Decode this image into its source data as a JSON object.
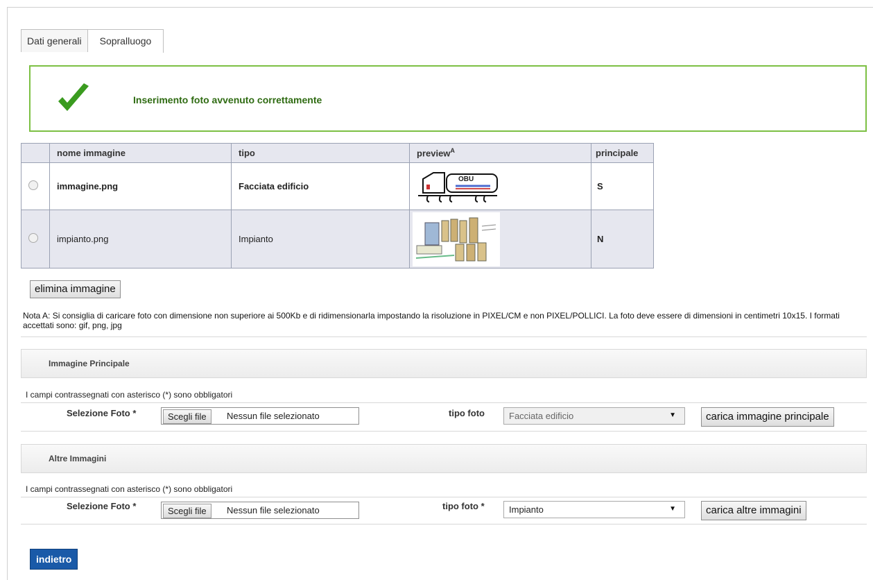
{
  "tabs": [
    "Dati generali",
    "Sopralluogo"
  ],
  "success_message": "Inserimento foto avvenuto correttamente",
  "table": {
    "headers": [
      "nome immagine",
      "tipo",
      "preview",
      "A",
      "principale"
    ],
    "rows": [
      {
        "name": "immagine.png",
        "type": "Facciata edificio",
        "principal": "S"
      },
      {
        "name": "impianto.png",
        "type": "Impianto",
        "principal": "N"
      }
    ]
  },
  "delete_button": "elimina immagine",
  "note": "Nota A: Si consiglia di caricare foto con dimensione non superiore ai 500Kb e di ridimensionarla impostando la risoluzione in PIXEL/CM e non PIXEL/POLLICI. La foto deve essere di dimensioni in centimetri 10x15. I formati accettati sono: gif, png, jpg",
  "main_section": {
    "title": "Immagine Principale",
    "required_note": "I campi contrassegnati con asterisco (*) sono obbligatori",
    "select_photo_label": "Selezione Foto *",
    "file_button": "Scegli file",
    "file_text": "Nessun file selezionato",
    "type_label": "tipo foto",
    "type_value": "Facciata edificio",
    "submit": "carica immagine principale"
  },
  "other_section": {
    "title": "Altre Immagini",
    "required_note": "I campi contrassegnati con asterisco (*) sono obbligatori",
    "select_photo_label": "Selezione Foto *",
    "file_button": "Scegli file",
    "file_text": "Nessun file selezionato",
    "type_label": "tipo foto *",
    "type_value": "Impianto",
    "submit": "carica altre immagini"
  },
  "back_button": "indietro",
  "colors": {
    "success_border": "#7cc043",
    "success_text": "#2f6b12",
    "primary_button": "#1a5aa8"
  }
}
